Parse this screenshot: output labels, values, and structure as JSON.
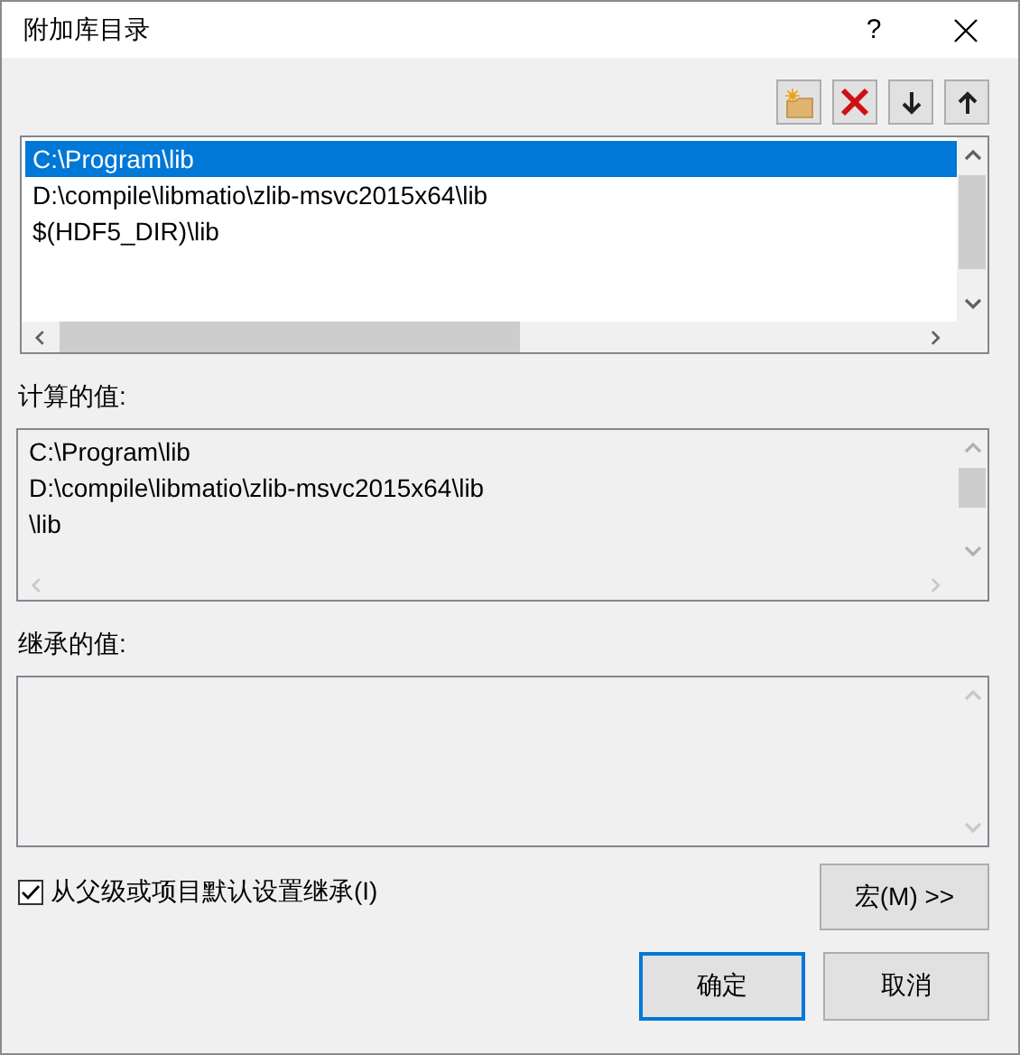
{
  "window": {
    "title": "附加库目录",
    "help": "?"
  },
  "directories": {
    "items": [
      {
        "text": "C:\\Program\\lib",
        "selected": true
      },
      {
        "text": "D:\\compile\\libmatio\\zlib-msvc2015x64\\lib",
        "selected": false
      },
      {
        "text": "$(HDF5_DIR)\\lib",
        "selected": false
      }
    ]
  },
  "computed": {
    "label": "计算的值:",
    "lines": [
      "C:\\Program\\lib",
      "D:\\compile\\libmatio\\zlib-msvc2015x64\\lib",
      "\\lib"
    ]
  },
  "inherited": {
    "label": "继承的值:"
  },
  "inherit_checkbox": {
    "label": "从父级或项目默认设置继承(I)",
    "checked": true
  },
  "macro_button": {
    "label": "宏(M) >>"
  },
  "buttons": [
    {
      "label": "确定",
      "default": true
    },
    {
      "label": "取消",
      "default": false
    }
  ]
}
